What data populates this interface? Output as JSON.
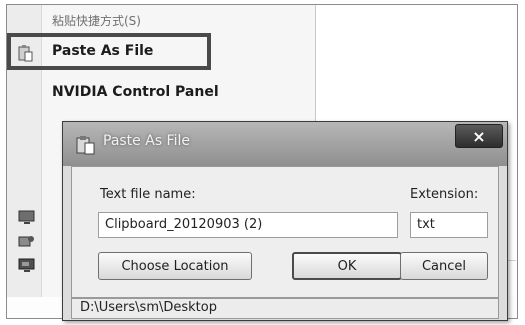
{
  "context_menu": {
    "items": [
      {
        "label": "粘贴快捷方式(S)",
        "icon": "none"
      },
      {
        "label": "Paste As File",
        "icon": "clipboard-icon"
      },
      {
        "label": "NVIDIA Control Panel",
        "icon": "none"
      }
    ]
  },
  "dialog": {
    "title": "Paste As File",
    "close_label": "×",
    "text_file_name_label": "Text file name:",
    "extension_label": "Extension:",
    "file_name_value": "Clipboard_20120903 (2)",
    "extension_value": "txt",
    "choose_location_label": "Choose Location",
    "ok_label": "OK",
    "cancel_label": "Cancel",
    "path": "D:\\Users\\sm\\Desktop"
  },
  "colors": {
    "highlight_border": "#4a4a4a",
    "titlebar": "#9f9f9f"
  }
}
